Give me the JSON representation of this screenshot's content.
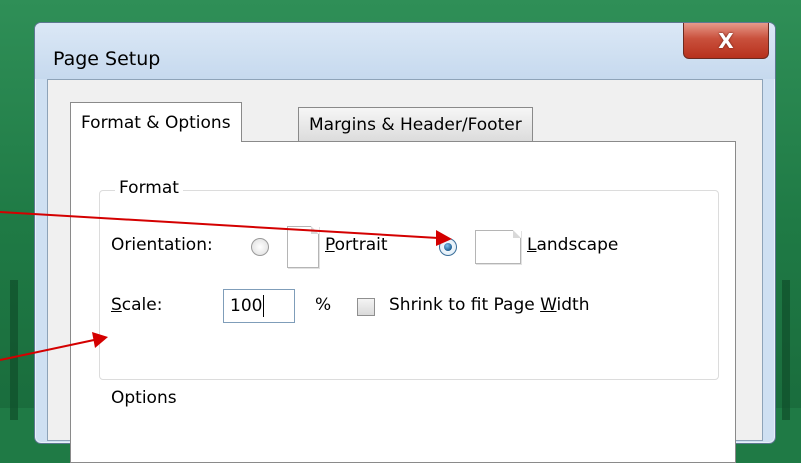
{
  "dialog": {
    "title": "Page Setup",
    "close_glyph": "X"
  },
  "tabs": [
    {
      "label": "Format & Options",
      "active": true
    },
    {
      "label": "Margins & Header/Footer",
      "active": false
    }
  ],
  "format_group": {
    "label": "Format",
    "orientation": {
      "label": "Orientation:",
      "options": [
        {
          "label_underlined": "P",
          "label_rest": "ortrait",
          "selected": false
        },
        {
          "label_underlined": "L",
          "label_rest": "andscape",
          "selected": true
        }
      ]
    },
    "scale": {
      "label_underlined": "S",
      "label_rest": "cale:",
      "value": "100",
      "unit": "%"
    },
    "shrink_to_fit": {
      "label_prefix": "Shrink to fit Page ",
      "label_underlined": "W",
      "label_suffix": "idth",
      "checked": false
    }
  },
  "next_group_label_partial": "Options",
  "colors": {
    "arrow": "#d40000",
    "background": "#1f7a45",
    "close_button": "#c9503c"
  }
}
